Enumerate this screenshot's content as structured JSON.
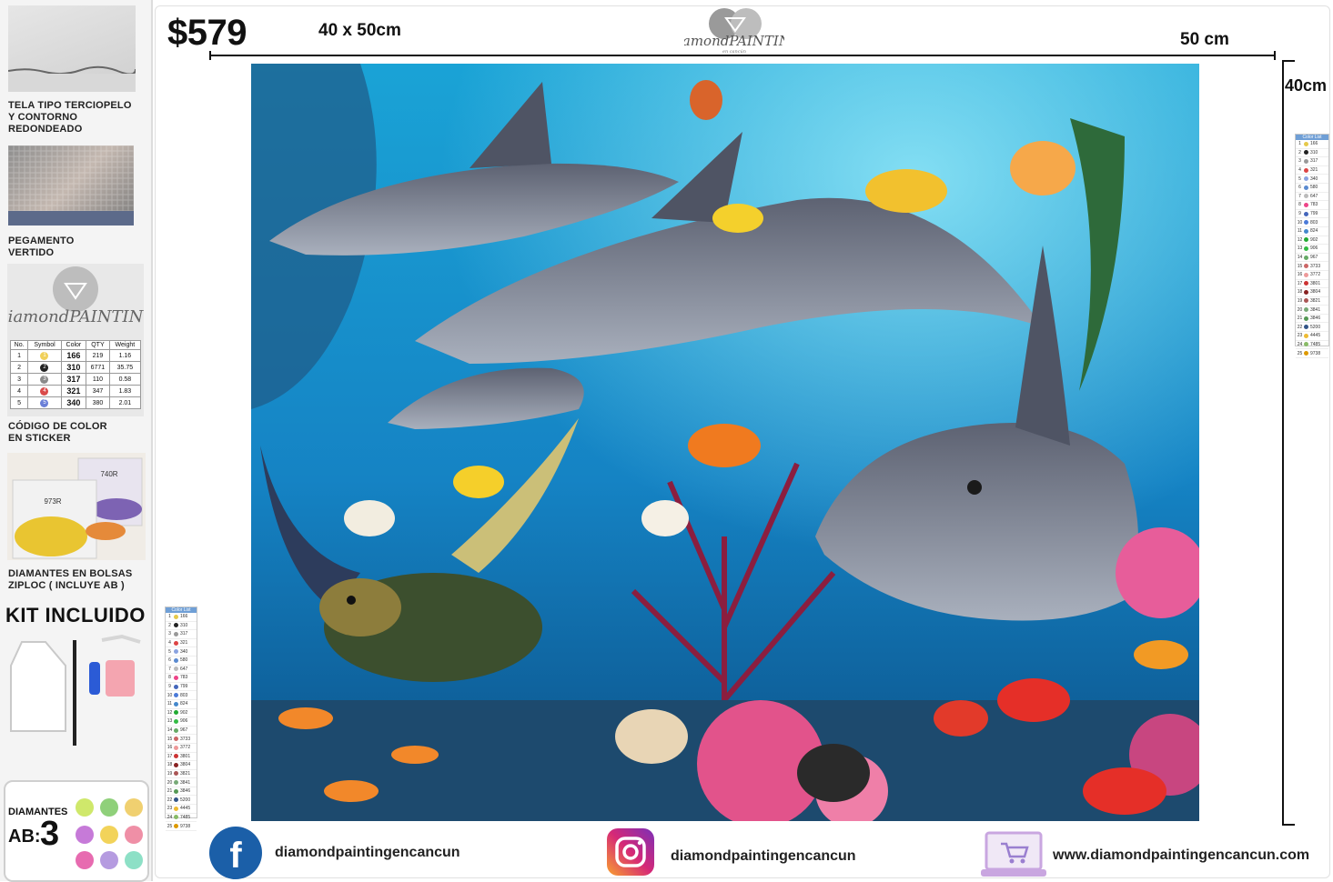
{
  "header": {
    "price": "$579",
    "size_top_left": "40 x 50cm",
    "width_label": "50 cm",
    "height_label": "40cm"
  },
  "logo": {
    "text": "DiamondPAINTING",
    "subtext": "en cancún"
  },
  "sidebar": {
    "items": [
      {
        "caption_line1": "TELA TIPO TERCIOPELO",
        "caption_line2": "Y CONTORNO REDONDEADO"
      },
      {
        "caption_line1": "PEGAMENTO",
        "caption_line2": "VERTIDO"
      },
      {
        "caption_line1": "CÓDIGO DE COLOR",
        "caption_line2": "EN STICKER"
      },
      {
        "caption_line1": "DIAMANTES EN BOLSAS",
        "caption_line2": "ZIPLOC ( INCLUYE AB )"
      }
    ],
    "kit_title": "KIT INCLUIDO",
    "diamonds_label": "DIAMANTES",
    "ab_label": "AB:",
    "ab_count": "3"
  },
  "sticker_table": {
    "headers": [
      "No.",
      "Symbol",
      "Color",
      "QTY",
      "Weight"
    ],
    "rows": [
      {
        "no": "1",
        "sym": "1",
        "color": "166",
        "qty": "219",
        "weight": "1.16"
      },
      {
        "no": "2",
        "sym": "2",
        "color": "310",
        "qty": "6771",
        "weight": "35.75"
      },
      {
        "no": "3",
        "sym": "3",
        "color": "317",
        "qty": "110",
        "weight": "0.58"
      },
      {
        "no": "4",
        "sym": "4",
        "color": "321",
        "qty": "347",
        "weight": "1.83"
      },
      {
        "no": "5",
        "sym": "5",
        "color": "340",
        "qty": "380",
        "weight": "2.01"
      }
    ]
  },
  "bag_labels": [
    "740R",
    "973R"
  ],
  "color_list": {
    "title": "Color List",
    "codes": [
      "166",
      "310",
      "317",
      "321",
      "340",
      "580",
      "647",
      "783",
      "799",
      "803",
      "824",
      "902",
      "906",
      "967",
      "3733",
      "3772",
      "3801",
      "3804",
      "3821",
      "3841",
      "3846",
      "5200",
      "4445",
      "7485",
      "9738"
    ]
  },
  "footer": {
    "facebook": "diamondpaintingencancun",
    "instagram": "diamondpaintingencancun",
    "website": "www.diamondpaintingencancun.com"
  },
  "colors": {
    "facebook_blue": "#1b5fa8",
    "instagram_pink": "#d62976",
    "ocean_top": "#1aa3d6",
    "ocean_deep": "#0b4f86"
  }
}
